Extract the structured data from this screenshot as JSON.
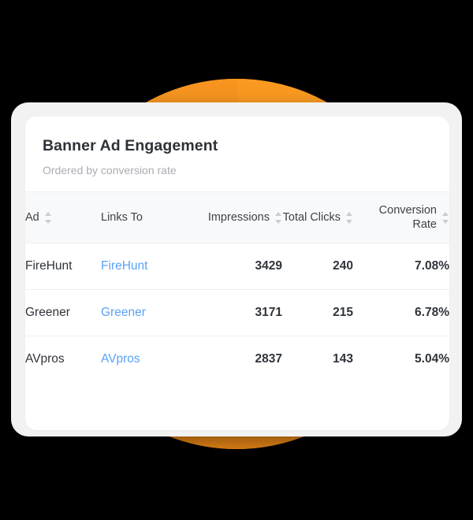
{
  "card": {
    "title": "Banner Ad Engagement",
    "subtitle": "Ordered by conversion rate"
  },
  "table": {
    "columns": [
      {
        "key": "ad",
        "label": "Ad",
        "sortable": true,
        "align": "left"
      },
      {
        "key": "links_to",
        "label": "Links To",
        "sortable": false,
        "align": "left"
      },
      {
        "key": "impressions",
        "label": "Impressions",
        "sortable": true,
        "align": "right"
      },
      {
        "key": "total_clicks",
        "label": "Total Clicks",
        "sortable": true,
        "align": "right"
      },
      {
        "key": "conv_rate",
        "label": "Conversion Rate",
        "sortable": true,
        "align": "right"
      }
    ],
    "rows": [
      {
        "ad": "FireHunt",
        "links_to": "FireHunt",
        "impressions": "3429",
        "total_clicks": "240",
        "conv_rate": "7.08%"
      },
      {
        "ad": "Greener",
        "links_to": "Greener",
        "impressions": "3171",
        "total_clicks": "215",
        "conv_rate": "6.78%"
      },
      {
        "ad": "AVpros",
        "links_to": "AVpros",
        "impressions": "2837",
        "total_clicks": "143",
        "conv_rate": "5.04%"
      }
    ]
  },
  "icons": {
    "sort": "sort-updown-icon"
  },
  "colors": {
    "background": "#000000",
    "accent_circle": "#F7941E",
    "link": "#5AA2F7",
    "title_text": "#2D3238",
    "subtitle_text": "#A9ACB1",
    "header_row_bg": "#F8F9FA",
    "card_bg": "#FFFFFF",
    "shell_bg": "#F2F2F3",
    "row_divider": "#EEF0F2",
    "sort_icon": "#C9CCD1"
  }
}
